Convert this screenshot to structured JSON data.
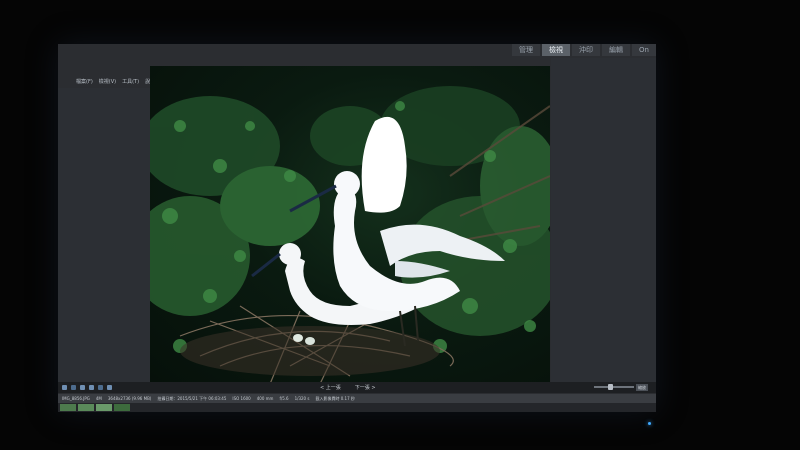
{
  "modules": [
    "管理",
    "檢視",
    "沖印",
    "編輯",
    "On"
  ],
  "active_module": 1,
  "menu": [
    "檔案(F)",
    "檢視(V)",
    "工具(T)",
    "說明(H)"
  ],
  "navigation": {
    "prev": "< 上一張",
    "next": "下一張 >"
  },
  "zoom_button": "縮放",
  "status": [
    "IMG_8856.JPG",
    "4M",
    "3648x2736 (9.96 MB)",
    "拍攝日期：2015/5/21 下午 06:03:45",
    "ISO 1600",
    "400 mm",
    "f/5.6",
    "1/320 s",
    "載入影像費時 0.17 秒"
  ],
  "colors": {
    "accent": "#5b6168",
    "panel": "#2c2f34",
    "photo_bg": "#0a1a10"
  }
}
